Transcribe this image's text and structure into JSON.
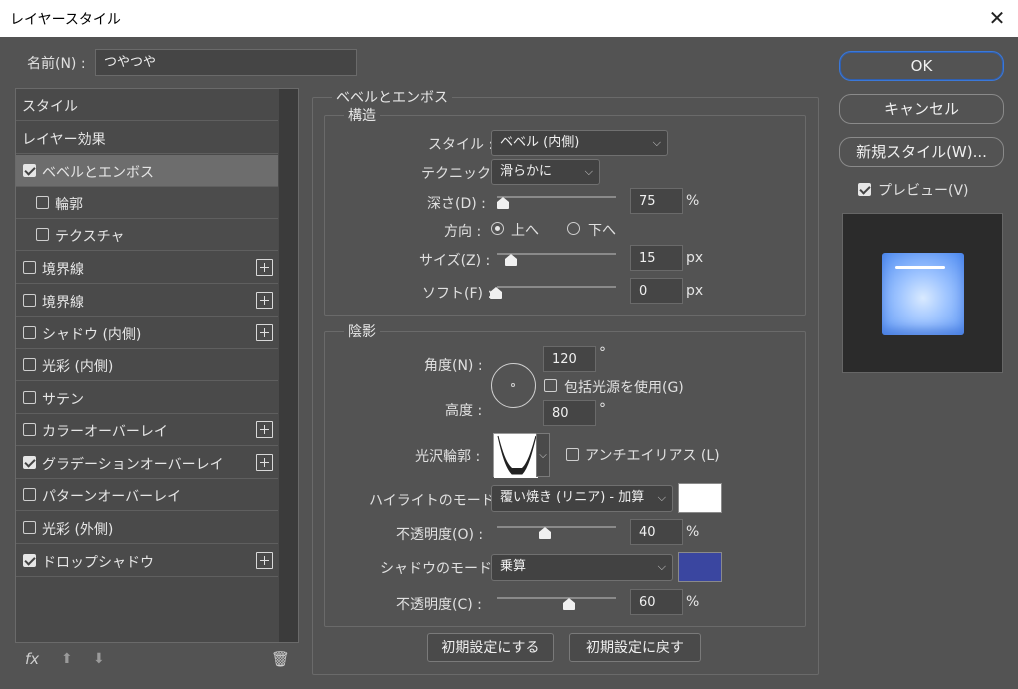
{
  "window": {
    "title": "レイヤースタイル",
    "close_glyph": "✕"
  },
  "name_field": {
    "label": "名前(N) :",
    "value": "つやつや"
  },
  "styles_list": [
    {
      "label": "スタイル",
      "checkbox": false,
      "checked": false,
      "plus": false,
      "selected": false
    },
    {
      "label": "レイヤー効果",
      "checkbox": false,
      "checked": false,
      "plus": false,
      "selected": false
    },
    {
      "label": "ベベルとエンボス",
      "checkbox": true,
      "checked": true,
      "plus": false,
      "selected": true
    },
    {
      "label": "輪郭",
      "checkbox": true,
      "checked": false,
      "plus": false,
      "selected": false,
      "sub": true
    },
    {
      "label": "テクスチャ",
      "checkbox": true,
      "checked": false,
      "plus": false,
      "selected": false,
      "sub": true
    },
    {
      "label": "境界線",
      "checkbox": true,
      "checked": false,
      "plus": true,
      "selected": false
    },
    {
      "label": "境界線",
      "checkbox": true,
      "checked": false,
      "plus": true,
      "selected": false
    },
    {
      "label": "シャドウ (内側)",
      "checkbox": true,
      "checked": false,
      "plus": true,
      "selected": false
    },
    {
      "label": "光彩 (内側)",
      "checkbox": true,
      "checked": false,
      "plus": false,
      "selected": false
    },
    {
      "label": "サテン",
      "checkbox": true,
      "checked": false,
      "plus": false,
      "selected": false
    },
    {
      "label": "カラーオーバーレイ",
      "checkbox": true,
      "checked": false,
      "plus": true,
      "selected": false
    },
    {
      "label": "グラデーションオーバーレイ",
      "checkbox": true,
      "checked": true,
      "plus": true,
      "selected": false
    },
    {
      "label": "パターンオーバーレイ",
      "checkbox": true,
      "checked": false,
      "plus": false,
      "selected": false
    },
    {
      "label": "光彩 (外側)",
      "checkbox": true,
      "checked": false,
      "plus": false,
      "selected": false
    },
    {
      "label": "ドロップシャドウ",
      "checkbox": true,
      "checked": true,
      "plus": true,
      "selected": false
    }
  ],
  "list_footer": {
    "fx": "fx",
    "up": "⬆",
    "down": "⬇",
    "trash": "🗑"
  },
  "bevel": {
    "section_title": "ベベルとエンボス",
    "structure_title": "構造",
    "style_label": "スタイル :",
    "style_value": "ベベル (内側)",
    "technique_label": "テクニック :",
    "technique_value": "滑らかに",
    "depth_label": "深さ(D) :",
    "depth_value": "75",
    "depth_unit": "%",
    "depth_level": 0.05,
    "direction_label": "方向 :",
    "direction_up": "上へ",
    "direction_down": "下へ",
    "direction_selected": "up",
    "size_label": "サイズ(Z) :",
    "size_value": "15",
    "size_unit": "px",
    "size_level": 0.1,
    "soften_label": "ソフト(F) :",
    "soften_value": "0",
    "soften_unit": "px",
    "soften_level": 0
  },
  "shading": {
    "title": "陰影",
    "angle_label": "角度(N) :",
    "angle_value": "120",
    "angle_unit": "°",
    "global_light_label": "包括光源を使用(G)",
    "global_light_checked": false,
    "altitude_label": "高度 :",
    "altitude_value": "80",
    "altitude_unit": "°",
    "gloss_label": "光沢輪郭 :",
    "antialias_label": "アンチエイリアス (L)",
    "antialias_checked": false,
    "highlight_mode_label": "ハイライトのモード :",
    "highlight_mode_value": "覆い焼き (リニア) - 加算",
    "highlight_color": "#ffffff",
    "highlight_opacity_label": "不透明度(O) :",
    "highlight_opacity_value": "40",
    "highlight_opacity_unit": "%",
    "highlight_opacity_level": 0.4,
    "shadow_mode_label": "シャドウのモード :",
    "shadow_mode_value": "乗算",
    "shadow_color": "#3a46a0",
    "shadow_opacity_label": "不透明度(C) :",
    "shadow_opacity_value": "60",
    "shadow_opacity_unit": "%",
    "shadow_opacity_level": 0.6
  },
  "bottom_buttons": {
    "make_default": "初期設定にする",
    "reset_default": "初期設定に戻す"
  },
  "right": {
    "ok": "OK",
    "cancel": "キャンセル",
    "new_style": "新規スタイル(W)...",
    "preview_label": "プレビュー(V)",
    "preview_checked": true
  },
  "icons": {
    "chevron": "chevron-down-icon",
    "check": "check-icon",
    "plus": "plus-icon"
  }
}
